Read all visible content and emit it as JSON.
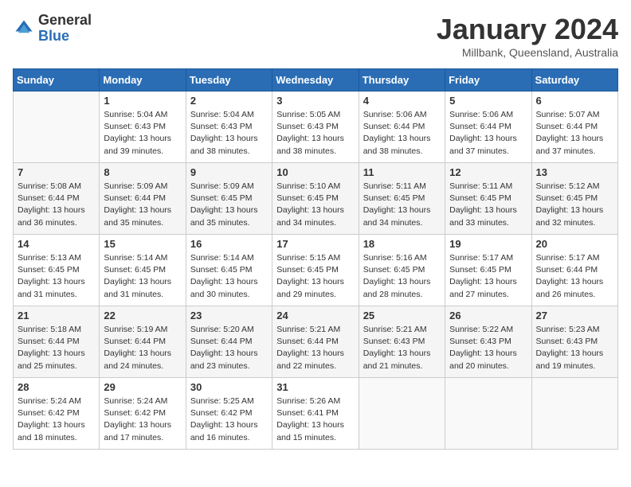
{
  "header": {
    "logo_general": "General",
    "logo_blue": "Blue",
    "month_title": "January 2024",
    "location": "Millbank, Queensland, Australia"
  },
  "days_of_week": [
    "Sunday",
    "Monday",
    "Tuesday",
    "Wednesday",
    "Thursday",
    "Friday",
    "Saturday"
  ],
  "weeks": [
    [
      {
        "day": "",
        "info": ""
      },
      {
        "day": "1",
        "info": "Sunrise: 5:04 AM\nSunset: 6:43 PM\nDaylight: 13 hours\nand 39 minutes."
      },
      {
        "day": "2",
        "info": "Sunrise: 5:04 AM\nSunset: 6:43 PM\nDaylight: 13 hours\nand 38 minutes."
      },
      {
        "day": "3",
        "info": "Sunrise: 5:05 AM\nSunset: 6:43 PM\nDaylight: 13 hours\nand 38 minutes."
      },
      {
        "day": "4",
        "info": "Sunrise: 5:06 AM\nSunset: 6:44 PM\nDaylight: 13 hours\nand 38 minutes."
      },
      {
        "day": "5",
        "info": "Sunrise: 5:06 AM\nSunset: 6:44 PM\nDaylight: 13 hours\nand 37 minutes."
      },
      {
        "day": "6",
        "info": "Sunrise: 5:07 AM\nSunset: 6:44 PM\nDaylight: 13 hours\nand 37 minutes."
      }
    ],
    [
      {
        "day": "7",
        "info": "Sunrise: 5:08 AM\nSunset: 6:44 PM\nDaylight: 13 hours\nand 36 minutes."
      },
      {
        "day": "8",
        "info": "Sunrise: 5:09 AM\nSunset: 6:44 PM\nDaylight: 13 hours\nand 35 minutes."
      },
      {
        "day": "9",
        "info": "Sunrise: 5:09 AM\nSunset: 6:45 PM\nDaylight: 13 hours\nand 35 minutes."
      },
      {
        "day": "10",
        "info": "Sunrise: 5:10 AM\nSunset: 6:45 PM\nDaylight: 13 hours\nand 34 minutes."
      },
      {
        "day": "11",
        "info": "Sunrise: 5:11 AM\nSunset: 6:45 PM\nDaylight: 13 hours\nand 34 minutes."
      },
      {
        "day": "12",
        "info": "Sunrise: 5:11 AM\nSunset: 6:45 PM\nDaylight: 13 hours\nand 33 minutes."
      },
      {
        "day": "13",
        "info": "Sunrise: 5:12 AM\nSunset: 6:45 PM\nDaylight: 13 hours\nand 32 minutes."
      }
    ],
    [
      {
        "day": "14",
        "info": "Sunrise: 5:13 AM\nSunset: 6:45 PM\nDaylight: 13 hours\nand 31 minutes."
      },
      {
        "day": "15",
        "info": "Sunrise: 5:14 AM\nSunset: 6:45 PM\nDaylight: 13 hours\nand 31 minutes."
      },
      {
        "day": "16",
        "info": "Sunrise: 5:14 AM\nSunset: 6:45 PM\nDaylight: 13 hours\nand 30 minutes."
      },
      {
        "day": "17",
        "info": "Sunrise: 5:15 AM\nSunset: 6:45 PM\nDaylight: 13 hours\nand 29 minutes."
      },
      {
        "day": "18",
        "info": "Sunrise: 5:16 AM\nSunset: 6:45 PM\nDaylight: 13 hours\nand 28 minutes."
      },
      {
        "day": "19",
        "info": "Sunrise: 5:17 AM\nSunset: 6:45 PM\nDaylight: 13 hours\nand 27 minutes."
      },
      {
        "day": "20",
        "info": "Sunrise: 5:17 AM\nSunset: 6:44 PM\nDaylight: 13 hours\nand 26 minutes."
      }
    ],
    [
      {
        "day": "21",
        "info": "Sunrise: 5:18 AM\nSunset: 6:44 PM\nDaylight: 13 hours\nand 25 minutes."
      },
      {
        "day": "22",
        "info": "Sunrise: 5:19 AM\nSunset: 6:44 PM\nDaylight: 13 hours\nand 24 minutes."
      },
      {
        "day": "23",
        "info": "Sunrise: 5:20 AM\nSunset: 6:44 PM\nDaylight: 13 hours\nand 23 minutes."
      },
      {
        "day": "24",
        "info": "Sunrise: 5:21 AM\nSunset: 6:44 PM\nDaylight: 13 hours\nand 22 minutes."
      },
      {
        "day": "25",
        "info": "Sunrise: 5:21 AM\nSunset: 6:43 PM\nDaylight: 13 hours\nand 21 minutes."
      },
      {
        "day": "26",
        "info": "Sunrise: 5:22 AM\nSunset: 6:43 PM\nDaylight: 13 hours\nand 20 minutes."
      },
      {
        "day": "27",
        "info": "Sunrise: 5:23 AM\nSunset: 6:43 PM\nDaylight: 13 hours\nand 19 minutes."
      }
    ],
    [
      {
        "day": "28",
        "info": "Sunrise: 5:24 AM\nSunset: 6:42 PM\nDaylight: 13 hours\nand 18 minutes."
      },
      {
        "day": "29",
        "info": "Sunrise: 5:24 AM\nSunset: 6:42 PM\nDaylight: 13 hours\nand 17 minutes."
      },
      {
        "day": "30",
        "info": "Sunrise: 5:25 AM\nSunset: 6:42 PM\nDaylight: 13 hours\nand 16 minutes."
      },
      {
        "day": "31",
        "info": "Sunrise: 5:26 AM\nSunset: 6:41 PM\nDaylight: 13 hours\nand 15 minutes."
      },
      {
        "day": "",
        "info": ""
      },
      {
        "day": "",
        "info": ""
      },
      {
        "day": "",
        "info": ""
      }
    ]
  ]
}
